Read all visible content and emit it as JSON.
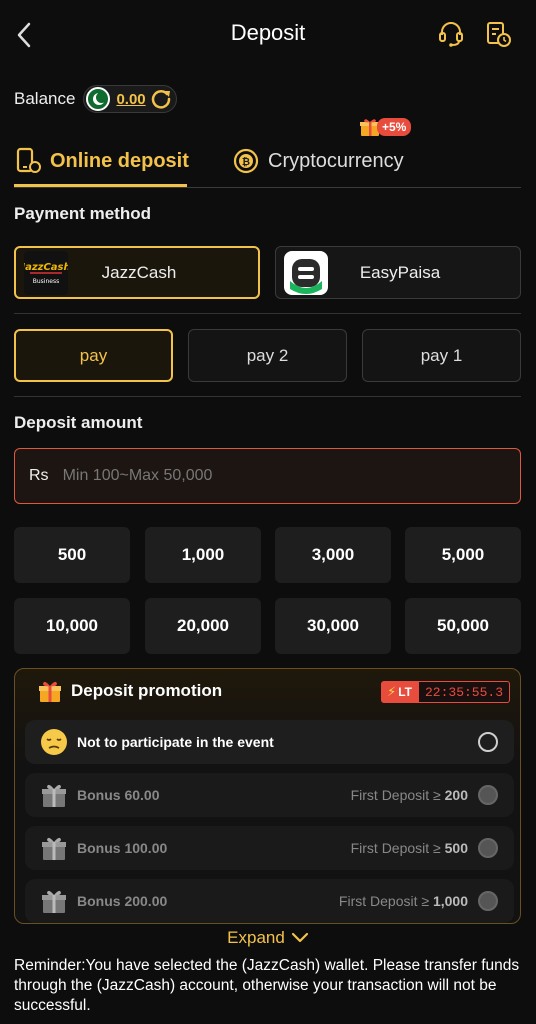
{
  "header": {
    "title": "Deposit"
  },
  "balance": {
    "label": "Balance",
    "value": "0.00"
  },
  "tabs": [
    {
      "label": "Online deposit",
      "active": true
    },
    {
      "label": "Cryptocurrency",
      "active": false,
      "badge": "+5%"
    }
  ],
  "payment_method": {
    "title": "Payment method",
    "methods": [
      {
        "label": "JazzCash",
        "logo_text": "JazzCash",
        "logo_sub": "Business",
        "active": true
      },
      {
        "label": "EasyPaisa",
        "active": false
      }
    ]
  },
  "channels": [
    {
      "label": "pay",
      "active": true
    },
    {
      "label": "pay 2",
      "active": false
    },
    {
      "label": "pay 1",
      "active": false
    }
  ],
  "deposit_amount": {
    "title": "Deposit amount",
    "currency": "Rs",
    "placeholder": "Min 100~Max 50,000",
    "quick_amounts": [
      "500",
      "1,000",
      "3,000",
      "5,000",
      "10,000",
      "20,000",
      "30,000",
      "50,000"
    ]
  },
  "promotion": {
    "title": "Deposit promotion",
    "timer_tag": "LT",
    "timer": "22:35:55.3",
    "options": [
      {
        "label": "Not to participate in the event",
        "type": "none"
      },
      {
        "label": "Bonus 60.00",
        "condition_prefix": "First Deposit ≥",
        "condition_value": "200"
      },
      {
        "label": "Bonus 100.00",
        "condition_prefix": "First Deposit ≥",
        "condition_value": "500"
      },
      {
        "label": "Bonus 200.00",
        "condition_prefix": "First Deposit ≥",
        "condition_value": "1,000"
      }
    ],
    "expand_label": "Expand"
  },
  "reminder": "Reminder:You have selected the (JazzCash) wallet. Please transfer funds through the (JazzCash) account, otherwise your transaction will not be successful.",
  "colors": {
    "accent": "#f3c24a",
    "error_border": "#e0593d",
    "badge_red": "#e74c3c"
  }
}
